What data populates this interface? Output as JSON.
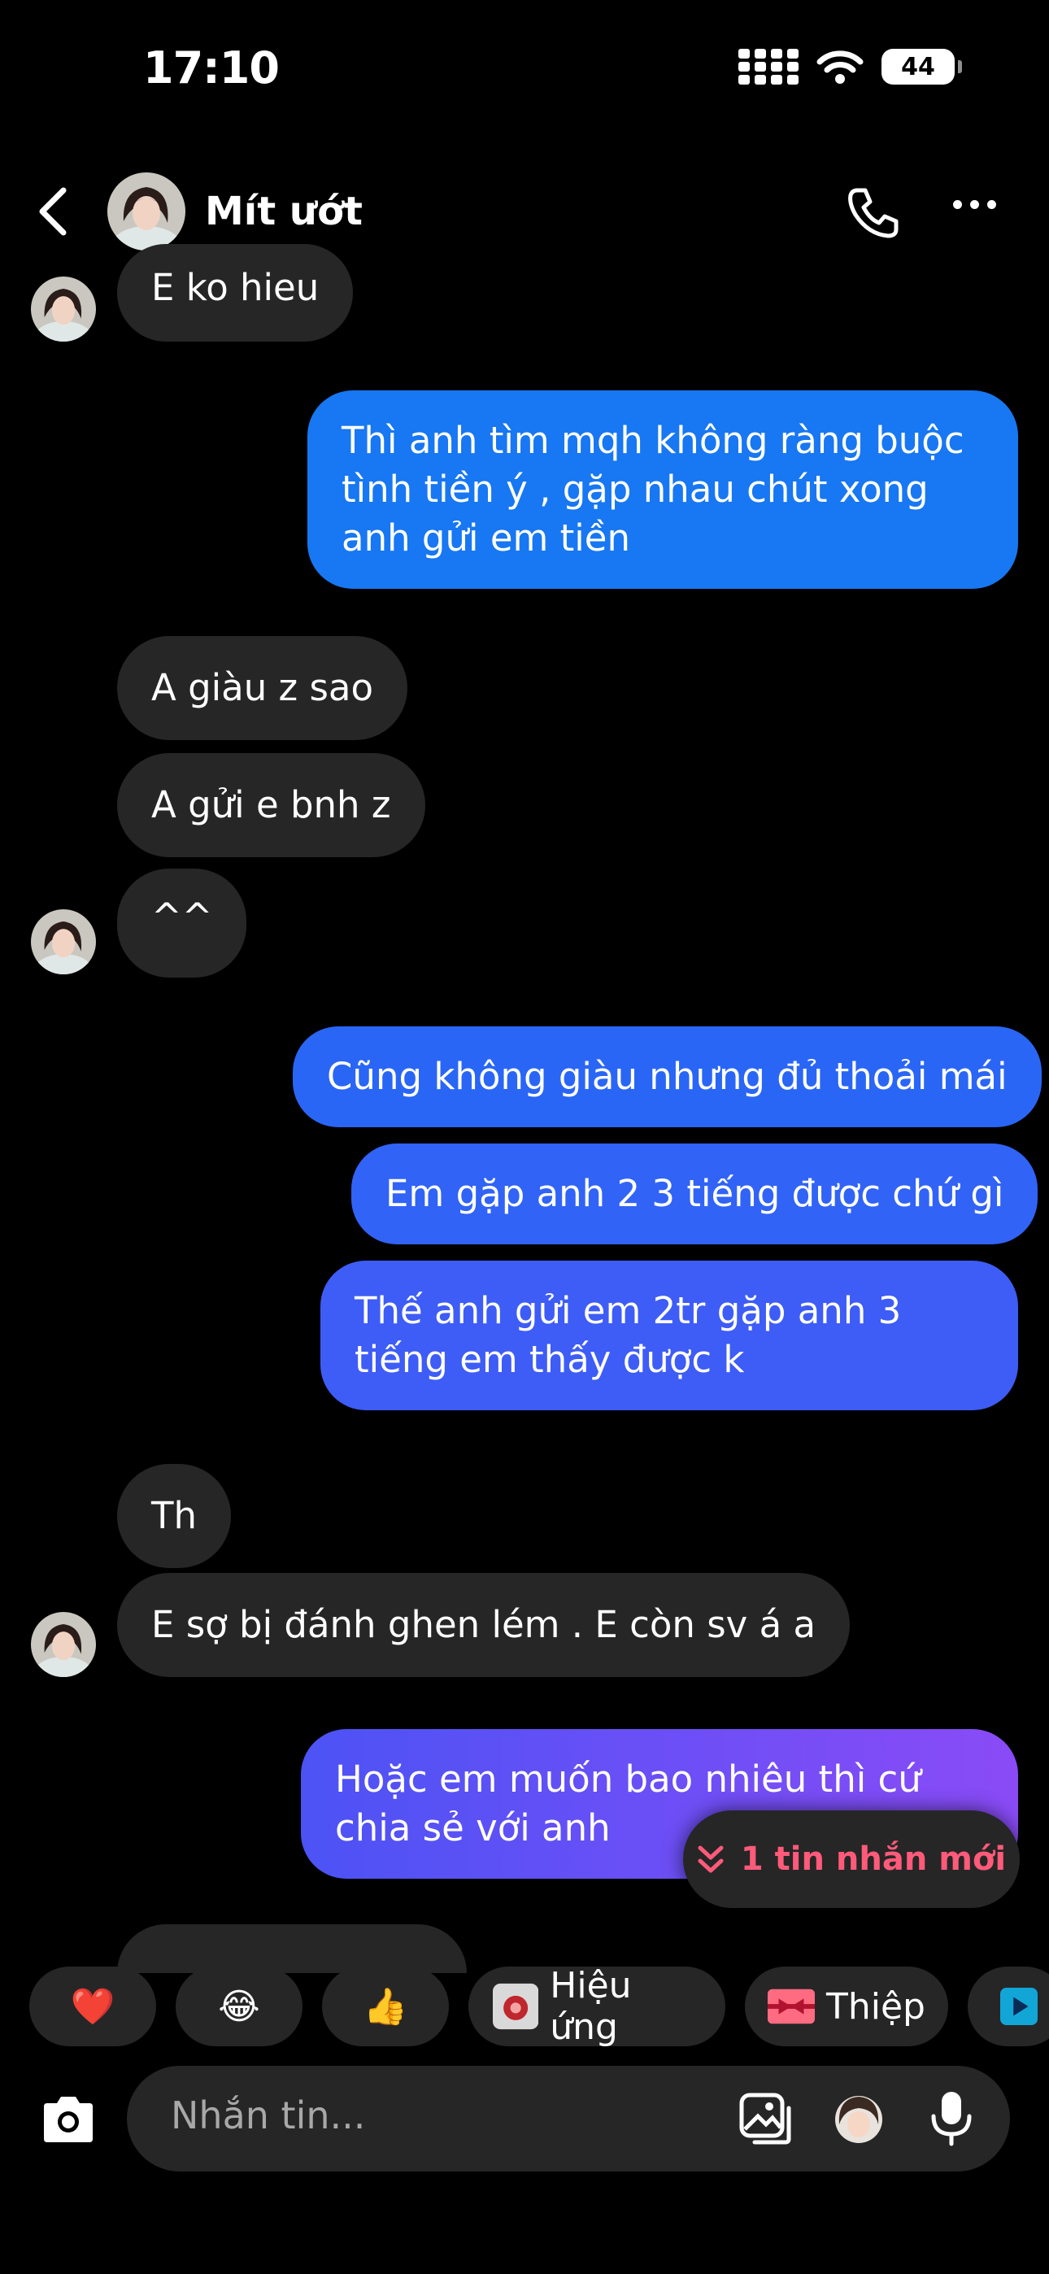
{
  "status": {
    "time": "17:10",
    "battery": "44"
  },
  "header": {
    "name": "Mít ướt"
  },
  "messages": [
    {
      "dir": "in",
      "text": "E ko hieu"
    },
    {
      "dir": "out",
      "text": "Thì anh tìm mqh không ràng buộc tình tiền ý , gặp nhau chút xong anh gửi em tiền"
    },
    {
      "dir": "in",
      "text": "A giàu z sao"
    },
    {
      "dir": "in",
      "text": "A gửi e bnh z"
    },
    {
      "dir": "in",
      "text": "^^"
    },
    {
      "dir": "out",
      "text": "Cũng không giàu nhưng đủ thoải mái"
    },
    {
      "dir": "out",
      "text": "Em gặp anh 2 3 tiếng được chứ gì"
    },
    {
      "dir": "out",
      "text": "Thế anh gửi em 2tr gặp anh 3 tiếng em thấy được k"
    },
    {
      "dir": "in",
      "text": "Th"
    },
    {
      "dir": "in",
      "text": "E sợ bị đánh ghen lém . E còn sv á a"
    },
    {
      "dir": "out",
      "text": "Hoặc em muốn bao nhiêu thì cứ chia sẻ với anh"
    }
  ],
  "new_message_pill": "1 tin nhắn mới",
  "quick_reactions": {
    "heart": "❤️",
    "laugh": "😂",
    "thumbs": "👍",
    "effects_label": "Hiệu ứng",
    "card_label": "Thiệp"
  },
  "composer": {
    "placeholder": "Nhắn tin..."
  },
  "colors": {
    "incoming_bubble": "#262626",
    "outgoing_top": "#1877F2",
    "outgoing_bottom": "#8A4BF6",
    "pill_text": "#FF5A7A"
  },
  "icons": [
    "back-icon",
    "phone-icon",
    "more-icon",
    "camera-icon",
    "gallery-icon",
    "sticker-icon",
    "microphone-icon",
    "chevrons-down-icon"
  ]
}
